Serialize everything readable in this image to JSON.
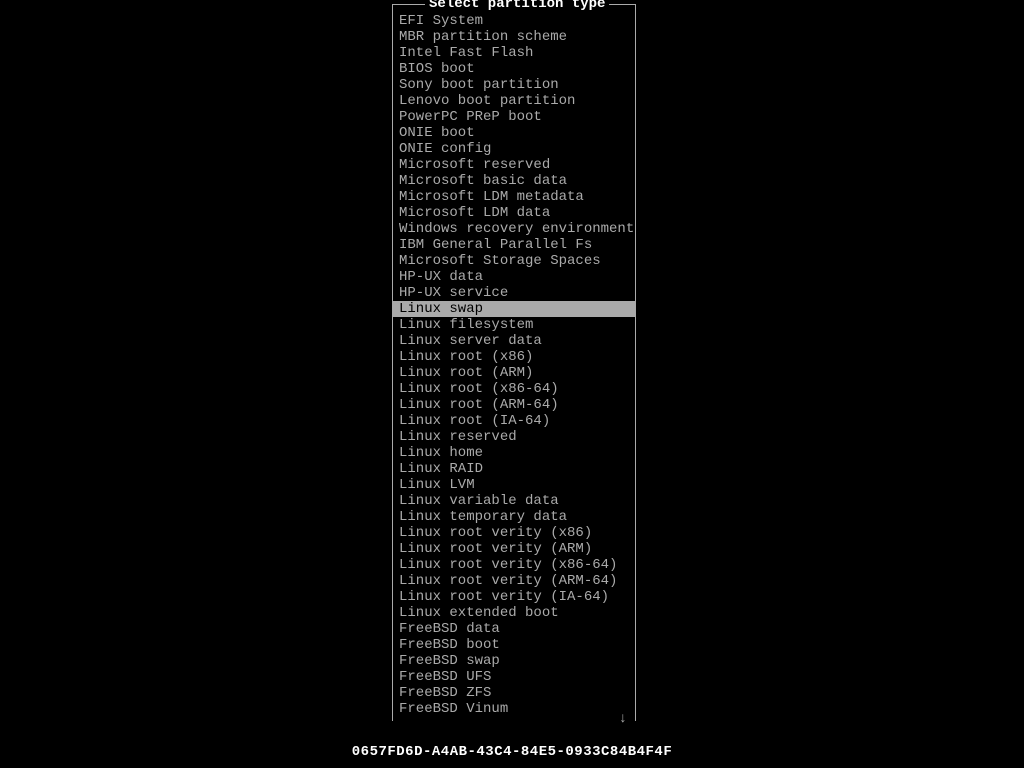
{
  "dialog": {
    "title": "Select partition type",
    "items": [
      {
        "label": "EFI System",
        "selected": false
      },
      {
        "label": "MBR partition scheme",
        "selected": false
      },
      {
        "label": "Intel Fast Flash",
        "selected": false
      },
      {
        "label": "BIOS boot",
        "selected": false
      },
      {
        "label": "Sony boot partition",
        "selected": false
      },
      {
        "label": "Lenovo boot partition",
        "selected": false
      },
      {
        "label": "PowerPC PReP boot",
        "selected": false
      },
      {
        "label": "ONIE boot",
        "selected": false
      },
      {
        "label": "ONIE config",
        "selected": false
      },
      {
        "label": "Microsoft reserved",
        "selected": false
      },
      {
        "label": "Microsoft basic data",
        "selected": false
      },
      {
        "label": "Microsoft LDM metadata",
        "selected": false
      },
      {
        "label": "Microsoft LDM data",
        "selected": false
      },
      {
        "label": "Windows recovery environment",
        "selected": false
      },
      {
        "label": "IBM General Parallel Fs",
        "selected": false
      },
      {
        "label": "Microsoft Storage Spaces",
        "selected": false
      },
      {
        "label": "HP-UX data",
        "selected": false
      },
      {
        "label": "HP-UX service",
        "selected": false
      },
      {
        "label": "Linux swap",
        "selected": true
      },
      {
        "label": "Linux filesystem",
        "selected": false
      },
      {
        "label": "Linux server data",
        "selected": false
      },
      {
        "label": "Linux root (x86)",
        "selected": false
      },
      {
        "label": "Linux root (ARM)",
        "selected": false
      },
      {
        "label": "Linux root (x86-64)",
        "selected": false
      },
      {
        "label": "Linux root (ARM-64)",
        "selected": false
      },
      {
        "label": "Linux root (IA-64)",
        "selected": false
      },
      {
        "label": "Linux reserved",
        "selected": false
      },
      {
        "label": "Linux home",
        "selected": false
      },
      {
        "label": "Linux RAID",
        "selected": false
      },
      {
        "label": "Linux LVM",
        "selected": false
      },
      {
        "label": "Linux variable data",
        "selected": false
      },
      {
        "label": "Linux temporary data",
        "selected": false
      },
      {
        "label": "Linux root verity (x86)",
        "selected": false
      },
      {
        "label": "Linux root verity (ARM)",
        "selected": false
      },
      {
        "label": "Linux root verity (x86-64)",
        "selected": false
      },
      {
        "label": "Linux root verity (ARM-64)",
        "selected": false
      },
      {
        "label": "Linux root verity (IA-64)",
        "selected": false
      },
      {
        "label": "Linux extended boot",
        "selected": false
      },
      {
        "label": "FreeBSD data",
        "selected": false
      },
      {
        "label": "FreeBSD boot",
        "selected": false
      },
      {
        "label": "FreeBSD swap",
        "selected": false
      },
      {
        "label": "FreeBSD UFS",
        "selected": false
      },
      {
        "label": "FreeBSD ZFS",
        "selected": false
      },
      {
        "label": "FreeBSD Vinum",
        "selected": false
      }
    ],
    "scroll_indicator": "↓"
  },
  "footer": {
    "text": "0657FD6D-A4AB-43C4-84E5-0933C84B4F4F"
  }
}
